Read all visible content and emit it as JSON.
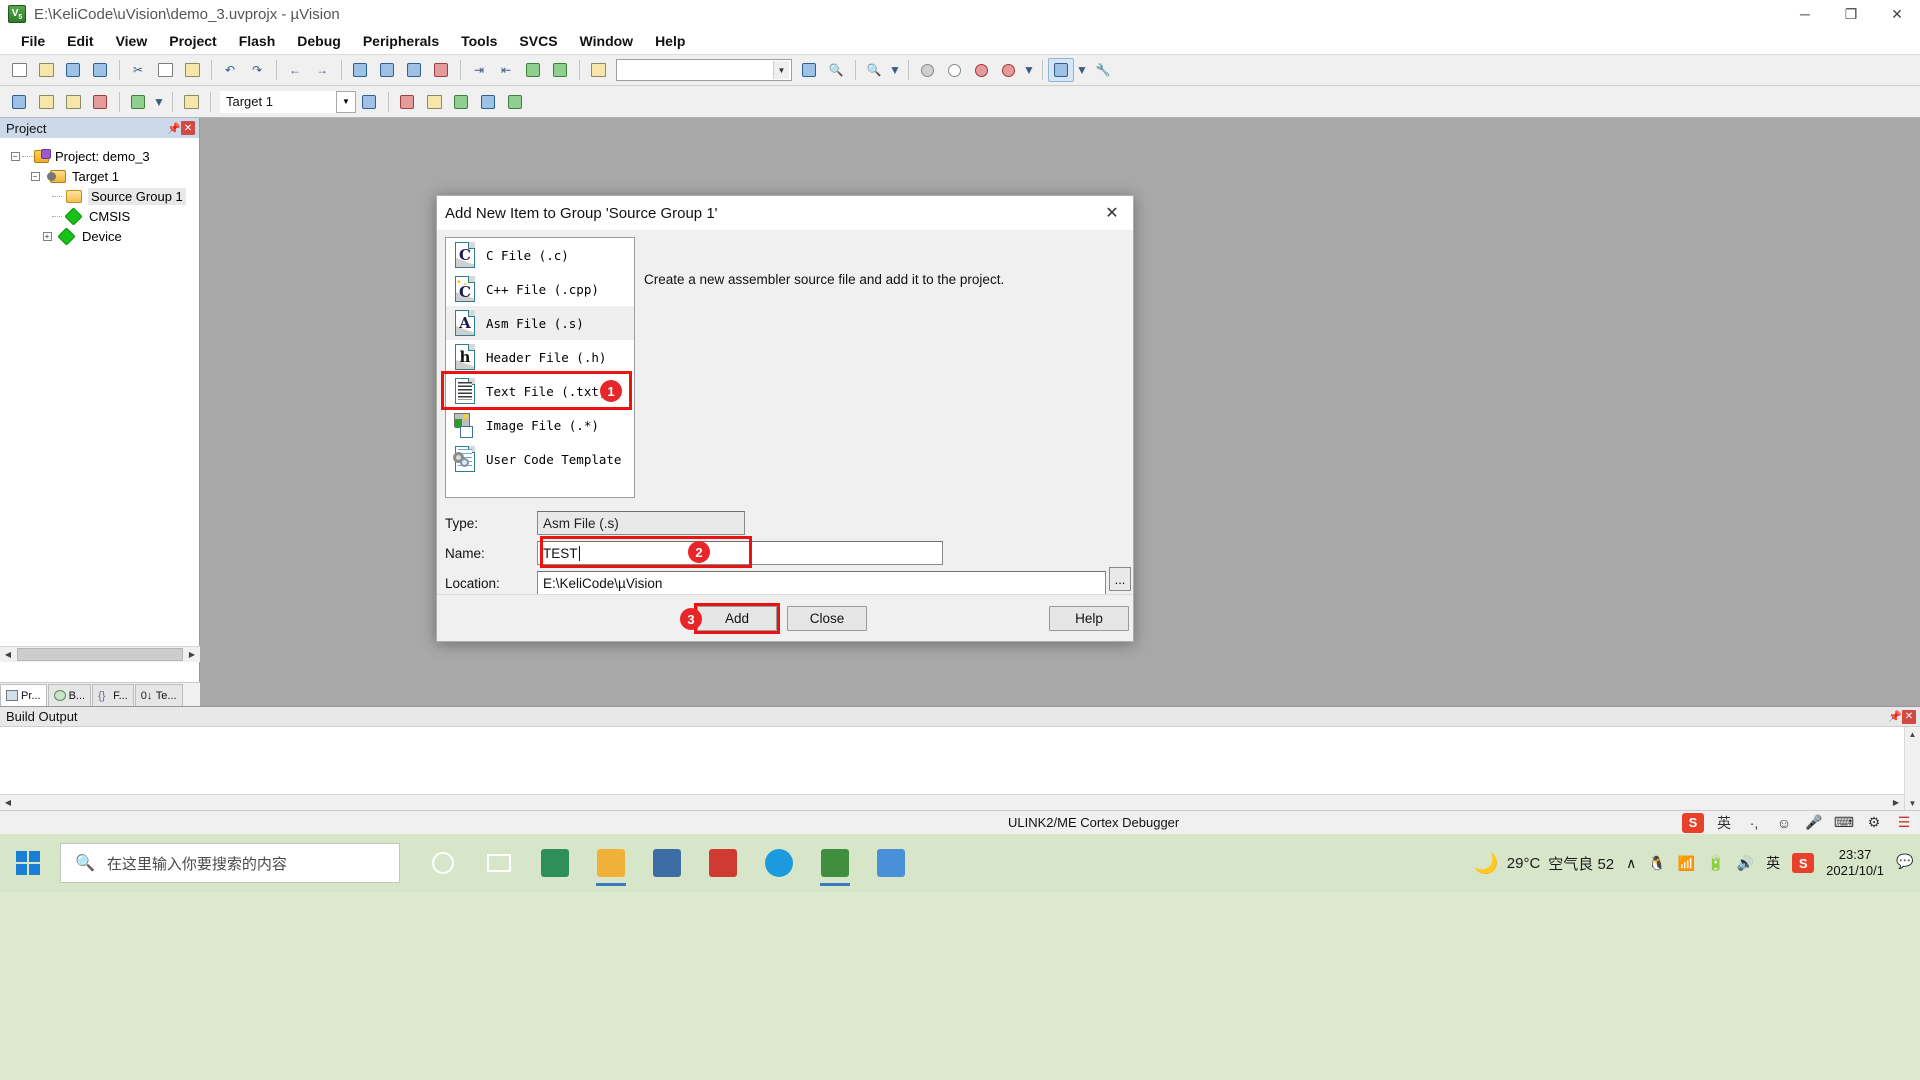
{
  "window": {
    "title": "E:\\KeliCode\\uVision\\demo_3.uvprojx - µVision",
    "app_icon": "keil-uvision-icon",
    "minimize": "─",
    "maximize": "❐",
    "close": "✕"
  },
  "menubar": {
    "items": [
      "File",
      "Edit",
      "View",
      "Project",
      "Flash",
      "Debug",
      "Peripherals",
      "Tools",
      "SVCS",
      "Window",
      "Help"
    ]
  },
  "toolbar1": {
    "search_value": "",
    "search_placeholder": ""
  },
  "toolbar2": {
    "target_value": "Target 1"
  },
  "project_panel": {
    "header": "Project",
    "pin": "📌",
    "close": "✕",
    "tree": [
      {
        "label": "Project: demo_3",
        "icon": "project-icon",
        "expander": "−",
        "indent": 0
      },
      {
        "label": "Target 1",
        "icon": "target-icon",
        "expander": "−",
        "indent": 1
      },
      {
        "label": "Source Group 1",
        "icon": "folder-icon",
        "expander": "",
        "indent": 2,
        "selected": true
      },
      {
        "label": "CMSIS",
        "icon": "diamond-icon",
        "expander": "",
        "indent": 2
      },
      {
        "label": "Device",
        "icon": "diamond-icon",
        "expander": "+",
        "indent": 2
      }
    ],
    "tabs": [
      {
        "label": "Pr...",
        "icon": "project-tab-icon",
        "active": true
      },
      {
        "label": "B...",
        "icon": "books-tab-icon",
        "active": false
      },
      {
        "label": "F...",
        "icon": "functions-tab-icon",
        "active": false
      },
      {
        "label": "Te...",
        "icon": "templates-tab-icon",
        "active": false
      }
    ]
  },
  "build_output": {
    "header": "Build Output",
    "pin": "📌",
    "close": "✕",
    "text": ""
  },
  "status_bar": {
    "debugger": "ULINK2/ME Cortex Debugger",
    "ime_lang": "英",
    "sogou": "S"
  },
  "dialog": {
    "title": "Add New Item to Group 'Source Group 1'",
    "close": "✕",
    "description": "Create a new assembler source file and add it to the project.",
    "file_types": [
      {
        "label": "C File (.c)",
        "icon": "c-file-icon",
        "selected": false
      },
      {
        "label": "C++ File (.cpp)",
        "icon": "cpp-file-icon",
        "selected": false
      },
      {
        "label": "Asm File (.s)",
        "icon": "asm-file-icon",
        "selected": true
      },
      {
        "label": "Header File (.h)",
        "icon": "header-file-icon",
        "selected": false
      },
      {
        "label": "Text File (.txt)",
        "icon": "text-file-icon",
        "selected": false
      },
      {
        "label": "Image File (.*)",
        "icon": "image-file-icon",
        "selected": false
      },
      {
        "label": "User Code Template",
        "icon": "user-code-template-icon",
        "selected": false
      }
    ],
    "fields": {
      "type_label": "Type:",
      "type_value": "Asm File (.s)",
      "name_label": "Name:",
      "name_value": "TEST",
      "location_label": "Location:",
      "location_value": "E:\\KeliCode\\µVision",
      "browse_label": "..."
    },
    "buttons": {
      "add": "Add",
      "close": "Close",
      "help": "Help"
    },
    "step_badges": [
      "1",
      "2",
      "3"
    ],
    "accent_color": "#ee1111"
  },
  "taskbar": {
    "search_placeholder": "在这里输入你要搜索的内容",
    "search_icon": "magnifier-icon",
    "start_icon": "windows-start-icon",
    "apps": [
      {
        "name": "cortana-icon",
        "color": "#ffffff"
      },
      {
        "name": "task-view-icon",
        "color": "#ffffff"
      },
      {
        "name": "store-icon",
        "color": "#2e8b57"
      },
      {
        "name": "file-explorer-icon",
        "color": "#f2b33a"
      },
      {
        "name": "mysql-icon",
        "color": "#3b6ea5"
      },
      {
        "name": "pdf-reader-icon",
        "color": "#d93b3b"
      },
      {
        "name": "edge-icon",
        "color": "#1a9be0"
      },
      {
        "name": "keil-uvision-icon",
        "color": "#3f8f3f"
      },
      {
        "name": "phone-link-icon",
        "color": "#4a90d9"
      }
    ],
    "weather": {
      "icon": "moon-icon",
      "temperature": "29°C",
      "air_quality": "空气良 52"
    },
    "tray": [
      "∧",
      "qq-penguin-icon",
      "wifi-icon",
      "battery-icon",
      "volume-icon",
      "ime-icon",
      "sogou-icon"
    ],
    "clock": {
      "time": "23:37",
      "date": "2021/10/1"
    },
    "show_desktop": "notification-icon"
  }
}
